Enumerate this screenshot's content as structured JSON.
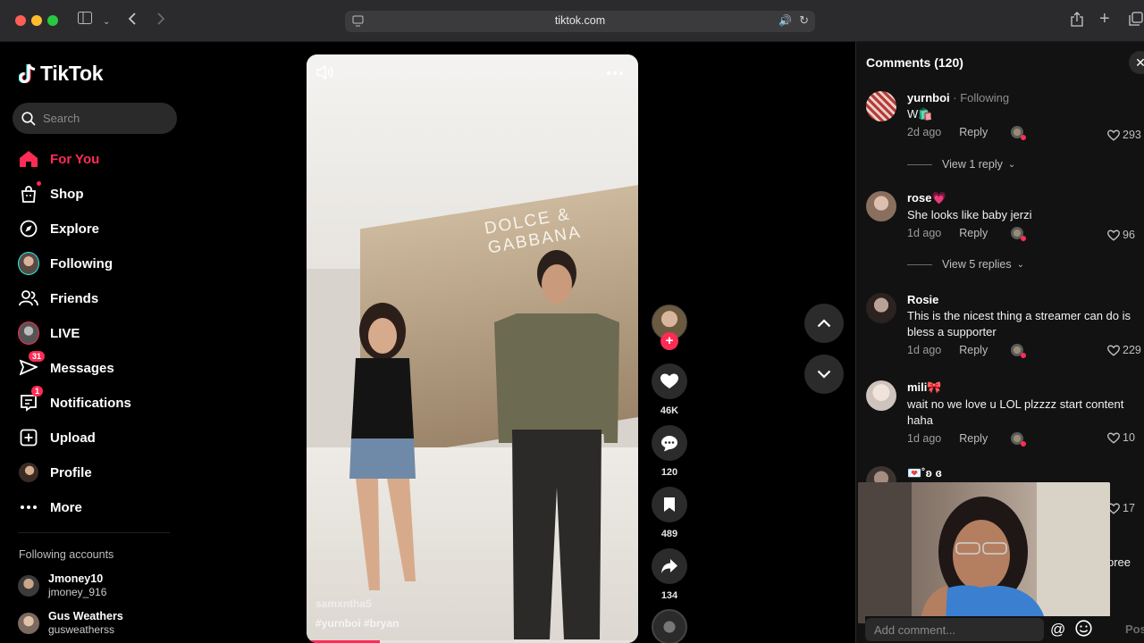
{
  "browser": {
    "url": "tiktok.com"
  },
  "app": {
    "name": "TikTok"
  },
  "search": {
    "placeholder": "Search"
  },
  "nav": {
    "items": [
      {
        "label": "For You",
        "icon": "home-icon",
        "active": true
      },
      {
        "label": "Shop",
        "icon": "shop-icon"
      },
      {
        "label": "Explore",
        "icon": "explore-icon"
      },
      {
        "label": "Following",
        "icon": "following-avatar"
      },
      {
        "label": "Friends",
        "icon": "friends-icon"
      },
      {
        "label": "LIVE",
        "icon": "live-icon"
      },
      {
        "label": "Messages",
        "icon": "messages-icon",
        "badge": "31"
      },
      {
        "label": "Notifications",
        "icon": "notifications-icon",
        "badge": "1"
      },
      {
        "label": "Upload",
        "icon": "upload-icon"
      },
      {
        "label": "Profile",
        "icon": "profile-avatar"
      },
      {
        "label": "More",
        "icon": "more-icon"
      }
    ],
    "following_title": "Following accounts",
    "accounts": [
      {
        "name": "Jmoney10",
        "handle": "jmoney_916"
      },
      {
        "name": "Gus Weathers",
        "handle": "gusweatherss"
      }
    ]
  },
  "video": {
    "username": "samxntha5",
    "tags": "#yurnboi  #bryan",
    "sign": "DOLCE & GABBANA",
    "progress": 0.22
  },
  "actions": {
    "likes": "46K",
    "comments": "120",
    "saves": "489",
    "shares": "134"
  },
  "comments": {
    "header": "Comments (120)",
    "items": [
      {
        "user": "yurnboi",
        "following": " · Following",
        "text": "W🛍️",
        "time": "2d ago",
        "reply": "Reply",
        "likes": "293",
        "view_replies": "View 1 reply"
      },
      {
        "user": "rose💗",
        "text": "She looks like baby jerzi",
        "time": "1d ago",
        "reply": "Reply",
        "likes": "96",
        "view_replies": "View 5 replies"
      },
      {
        "user": "Rosie",
        "text": "This is the nicest thing a streamer can do is bless a supporter",
        "time": "1d ago",
        "reply": "Reply",
        "likes": "229"
      },
      {
        "user": "mili🎀",
        "text": "wait no we love u LOL plzzzz start content haha",
        "time": "1d ago",
        "reply": "Reply",
        "likes": "10"
      },
      {
        "user": "💌˚ʚ ɞ",
        "text": "",
        "likes": "17"
      }
    ],
    "partial_text": "pree",
    "add_placeholder": "Add comment...",
    "post_label": "Post"
  }
}
